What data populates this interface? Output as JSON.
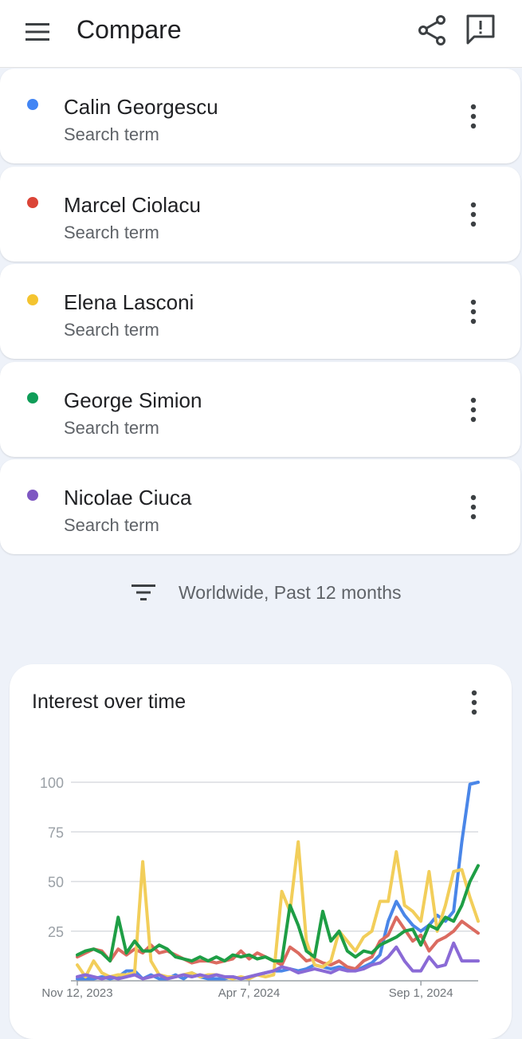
{
  "header": {
    "title": "Compare",
    "menu_icon": "hamburger-menu-icon",
    "share_icon": "share-icon",
    "feedback_icon": "feedback-icon"
  },
  "terms": [
    {
      "name": "Calin Georgescu",
      "type": "Search term",
      "color": "#4285f4"
    },
    {
      "name": "Marcel Ciolacu",
      "type": "Search term",
      "color": "#db4437"
    },
    {
      "name": "Elena Lasconi",
      "type": "Search term",
      "color": "#f4b400"
    },
    {
      "name": "George Simion",
      "type": "Search term",
      "color": "#0f9d58"
    },
    {
      "name": "Nicolae Ciuca",
      "type": "Search term",
      "color": "#7e57c2"
    }
  ],
  "filter": {
    "label": "Worldwide, Past 12 months",
    "icon": "filter-icon"
  },
  "chart_card": {
    "title": "Interest over time",
    "menu_icon": "more-vert-icon"
  },
  "chart_data": {
    "type": "line",
    "title": "Interest over time",
    "xlabel": "",
    "ylabel": "",
    "ylim": [
      0,
      100
    ],
    "yticks": [
      "100",
      "75",
      "50",
      "25"
    ],
    "xtick_labels": [
      "Nov 12, 2023",
      "Apr 7, 2024",
      "Sep 1, 2024"
    ],
    "xtick_weeks": [
      0,
      21,
      42
    ],
    "grid": true,
    "legend": "none",
    "series": [
      {
        "name": "Calin Georgescu",
        "color": "#4a86e8",
        "values": [
          1,
          1,
          1,
          2,
          1,
          2,
          5,
          5,
          1,
          3,
          1,
          1,
          3,
          1,
          4,
          2,
          1,
          1,
          1,
          2,
          1,
          2,
          3,
          4,
          5,
          5,
          6,
          5,
          6,
          8,
          7,
          6,
          7,
          6,
          5,
          7,
          9,
          13,
          30,
          40,
          33,
          28,
          25,
          28,
          33,
          30,
          35,
          70,
          99,
          100
        ]
      },
      {
        "name": "Marcel Ciolacu",
        "color": "#db6b60",
        "values": [
          12,
          14,
          16,
          15,
          10,
          16,
          13,
          16,
          14,
          18,
          14,
          15,
          13,
          11,
          9,
          10,
          10,
          9,
          10,
          11,
          15,
          11,
          14,
          12,
          10,
          8,
          17,
          14,
          10,
          11,
          9,
          8,
          10,
          7,
          6,
          10,
          12,
          20,
          23,
          32,
          26,
          20,
          23,
          15,
          20,
          22,
          25,
          30,
          27,
          24
        ]
      },
      {
        "name": "Elena Lasconi",
        "color": "#f2ce5a",
        "values": [
          8,
          2,
          10,
          4,
          2,
          3,
          3,
          4,
          60,
          10,
          3,
          2,
          2,
          3,
          4,
          2,
          3,
          3,
          2,
          1,
          2,
          1,
          3,
          2,
          3,
          45,
          35,
          70,
          20,
          8,
          7,
          10,
          25,
          20,
          15,
          22,
          25,
          40,
          40,
          65,
          38,
          35,
          30,
          55,
          25,
          38,
          55,
          56,
          42,
          30
        ]
      },
      {
        "name": "George Simion",
        "color": "#1e9e45",
        "values": [
          13,
          15,
          16,
          14,
          10,
          32,
          14,
          20,
          15,
          15,
          18,
          16,
          12,
          11,
          10,
          12,
          10,
          12,
          10,
          13,
          12,
          13,
          11,
          12,
          10,
          10,
          38,
          28,
          15,
          12,
          35,
          20,
          25,
          15,
          12,
          15,
          14,
          18,
          20,
          22,
          25,
          26,
          18,
          28,
          26,
          32,
          30,
          38,
          50,
          58
        ]
      },
      {
        "name": "Nicolae Ciuca",
        "color": "#8a6ad6",
        "values": [
          2,
          3,
          2,
          1,
          2,
          1,
          2,
          3,
          1,
          2,
          3,
          1,
          2,
          3,
          2,
          3,
          2,
          3,
          2,
          2,
          1,
          2,
          3,
          4,
          5,
          7,
          6,
          4,
          5,
          6,
          5,
          4,
          6,
          5,
          5,
          6,
          8,
          9,
          12,
          17,
          10,
          5,
          5,
          12,
          7,
          8,
          19,
          10,
          10,
          10
        ]
      }
    ]
  }
}
